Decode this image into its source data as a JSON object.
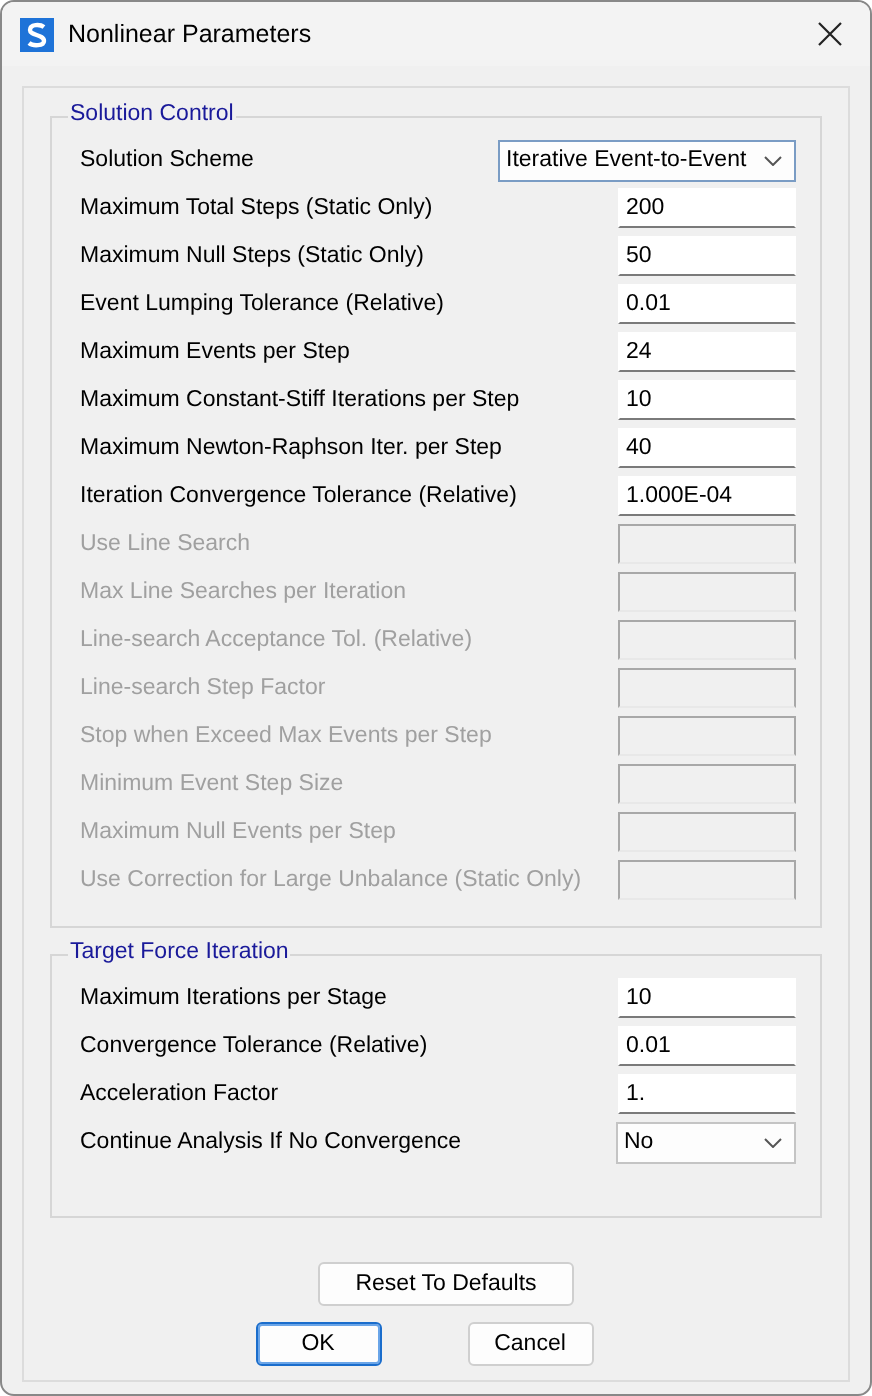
{
  "window": {
    "title": "Nonlinear Parameters"
  },
  "groups": [
    {
      "title": "Solution Control",
      "rows": [
        {
          "label": "Solution Scheme",
          "kind": "combo",
          "value": "Iterative Event-to-Event",
          "disabled": false
        },
        {
          "label": "Maximum Total Steps (Static Only)",
          "kind": "text",
          "value": "200",
          "disabled": false
        },
        {
          "label": "Maximum Null Steps (Static Only)",
          "kind": "text",
          "value": "50",
          "disabled": false
        },
        {
          "label": "Event Lumping Tolerance (Relative)",
          "kind": "text",
          "value": "0.01",
          "disabled": false
        },
        {
          "label": "Maximum Events per Step",
          "kind": "text",
          "value": "24",
          "disabled": false
        },
        {
          "label": "Maximum Constant-Stiff Iterations per Step",
          "kind": "text",
          "value": "10",
          "disabled": false
        },
        {
          "label": "Maximum Newton-Raphson Iter. per Step",
          "kind": "text",
          "value": "40",
          "disabled": false
        },
        {
          "label": "Iteration Convergence Tolerance (Relative)",
          "kind": "text",
          "value": "1.000E-04",
          "disabled": false
        },
        {
          "label": "Use Line Search",
          "kind": "text",
          "disabled": true
        },
        {
          "label": "Max Line Searches per Iteration",
          "kind": "text",
          "disabled": true
        },
        {
          "label": "Line-search Acceptance Tol. (Relative)",
          "kind": "text",
          "disabled": true
        },
        {
          "label": "Line-search Step Factor",
          "kind": "text",
          "disabled": true
        },
        {
          "label": "Stop when Exceed Max Events per Step",
          "kind": "text",
          "disabled": true
        },
        {
          "label": "Minimum Event Step Size",
          "kind": "text",
          "disabled": true
        },
        {
          "label": "Maximum Null Events per Step",
          "kind": "text",
          "disabled": true
        },
        {
          "label": "Use Correction for Large Unbalance (Static Only)",
          "kind": "text",
          "disabled": true
        }
      ]
    },
    {
      "title": "Target Force Iteration",
      "rows": [
        {
          "label": "Maximum Iterations per Stage",
          "kind": "text",
          "value": "10",
          "disabled": false
        },
        {
          "label": "Convergence Tolerance (Relative)",
          "kind": "text",
          "value": "0.01",
          "disabled": false
        },
        {
          "label": "Acceleration Factor",
          "kind": "text",
          "value": "1.",
          "disabled": false
        },
        {
          "label": "Continue Analysis If No Convergence",
          "kind": "small-combo",
          "value": "No",
          "disabled": false
        }
      ]
    }
  ],
  "reset_button": "Reset To Defaults",
  "buttons": [
    {
      "label": "OK",
      "default": true
    },
    {
      "label": "Cancel",
      "default": false
    }
  ]
}
